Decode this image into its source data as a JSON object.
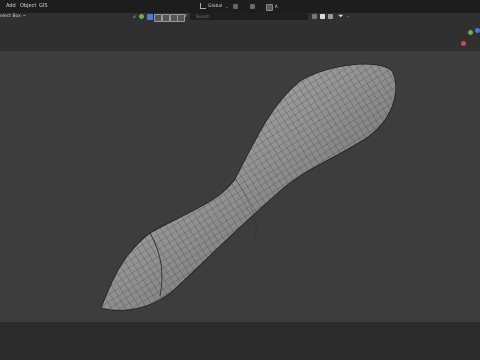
{
  "menu": {
    "add": "Add",
    "object": "Object",
    "gis": "GIS"
  },
  "toolbar": {
    "select_tool": "elect Box ~",
    "transform_orientation": "Global",
    "search_placeholder": "Search"
  },
  "colors": {
    "menubar_bg": "#1d1d1d",
    "toolbar_bg": "#303030",
    "viewport_bg": "#3d3d3d",
    "statusbar_bg": "#2b2b2b",
    "active_icon": "#4a7bd6",
    "gizmo_red": "#d24848",
    "gizmo_green": "#6bb04a",
    "gizmo_blue": "#4a78d6",
    "mesh_fill": "#8c8c8c",
    "mesh_wire": "#2a2a2a"
  },
  "icons": [
    "cursor-icon",
    "sphere-icon",
    "select-mode-icon",
    "shading-icon",
    "overlay-icon",
    "pivot-icon",
    "snap-icon",
    "proportional-icon",
    "search-icon",
    "filter-icon",
    "gizmo-axes"
  ]
}
